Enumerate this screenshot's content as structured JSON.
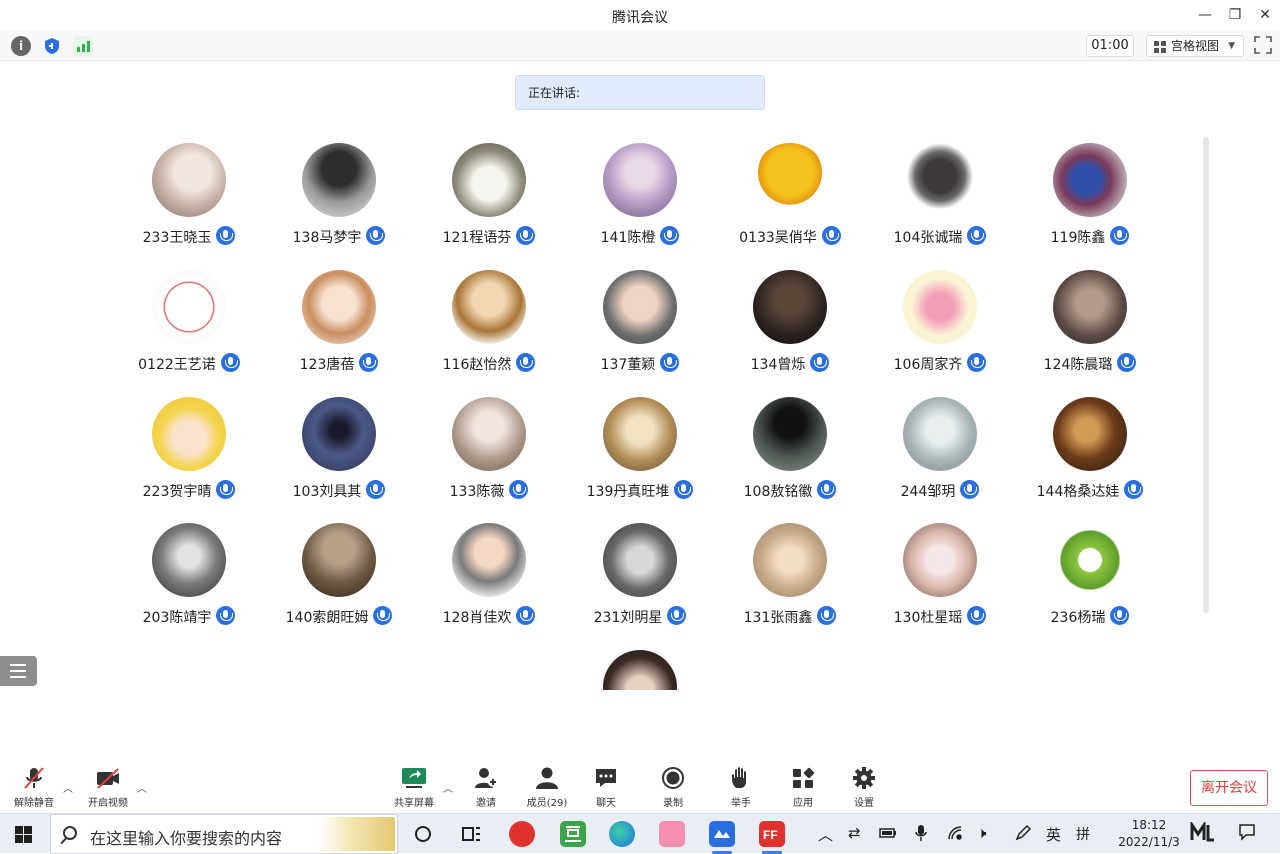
{
  "window": {
    "title": "腾讯会议",
    "controls": [
      "—",
      "❐",
      "✕"
    ]
  },
  "toolbar": {
    "timer": "01:00",
    "view_label": "宫格视图"
  },
  "speaking": {
    "label": "正在讲话:"
  },
  "participants": [
    {
      "name": "233王晓玉",
      "avatar_bg": "radial-gradient(circle at 55% 40%, #f1e6df 0 30%, #c7b3a6 55%, #7b6a60 100%)"
    },
    {
      "name": "138马梦宇",
      "avatar_bg": "radial-gradient(circle at 50% 35%, #2d2d2d 0 28%, #9a9a9a 55%, #e5e5e5 100%)"
    },
    {
      "name": "121程语芬",
      "avatar_bg": "radial-gradient(circle at 50% 55%, #f5f5f0 0 30%, #8e8a78 60%, #4b4538 100%)"
    },
    {
      "name": "141陈橙",
      "avatar_bg": "radial-gradient(circle at 50% 40%, #e9d9e6 0 25%, #b39bc4 55%, #6a5a7d 100%)"
    },
    {
      "name": "0133吴俏华",
      "avatar_bg": "radial-gradient(circle at 50% 40%, #f4c21a 0 40%, #e79a12 55%, #ffffff 56%, #ffffff 100%)"
    },
    {
      "name": "104张诚瑞",
      "avatar_bg": "radial-gradient(circle at 50% 45%, #3e3a3a 0 30%, #6b6b6b 45%, #ffffff 60%, #ffffff 100%)"
    },
    {
      "name": "119陈鑫",
      "avatar_bg": "radial-gradient(circle at 45% 50%, #2d4ea8 0 25%, #7b3a5a 45%, #c9c2c8 80%)"
    },
    {
      "name": "0122王艺诺",
      "avatar_bg": "radial-gradient(circle at 50% 50%, #ffffff 0 45%, #d05a5a 47%, #ffffff 50%, #f7f0f0 100%)"
    },
    {
      "name": "123唐蓓",
      "avatar_bg": "radial-gradient(circle at 50% 45%, #f8e3d2 0 30%, #c98e5f 55%, #fdf4ec 100%)"
    },
    {
      "name": "116赵怡然",
      "avatar_bg": "radial-gradient(circle at 50% 40%, #f3d7b2 0 28%, #a77537 55%, #ffffff 80%)"
    },
    {
      "name": "137董颖",
      "avatar_bg": "radial-gradient(circle at 50% 45%, #f1d5c4 0 30%, #6e6e6e 60%, #3a4a3e 100%)"
    },
    {
      "name": "134曾烁",
      "avatar_bg": "radial-gradient(circle at 50% 40%, #5a4638 0 25%, #2a2220 60%, #0f0c0a 100%)"
    },
    {
      "name": "106周家齐",
      "avatar_bg": "radial-gradient(circle at 50% 50%, #f29cb6 0 25%, #fbf5d7 55%, #f6efc6 100%)"
    },
    {
      "name": "124陈晨璐",
      "avatar_bg": "radial-gradient(circle at 50% 45%, #b59a8a 0 25%, #5a4a44 60%, #2a2422 100%)"
    },
    {
      "name": "223贺宇晴",
      "avatar_bg": "radial-gradient(circle at 50% 55%, #fbe2cc 0 30%, #f3d44a 55%, #eac33a 100%)"
    },
    {
      "name": "103刘具其",
      "avatar_bg": "radial-gradient(circle at 50% 45%, #1a1a2a 0 15%, #4d5a88 45%, #283254 100%)"
    },
    {
      "name": "133陈薇",
      "avatar_bg": "radial-gradient(circle at 50% 40%, #f0e6df 0 25%, #a89384 60%, #6e5f55 100%)"
    },
    {
      "name": "139丹真旺堆",
      "avatar_bg": "radial-gradient(circle at 50% 45%, #f1e2c2 0 25%, #b58f5a 55%, #5a4632 100%)"
    },
    {
      "name": "108敖铭徽",
      "avatar_bg": "radial-gradient(circle at 50% 35%, #111 0 25%, #4f5752 55%, #8c948e 100%)"
    },
    {
      "name": "244邹玥",
      "avatar_bg": "radial-gradient(circle at 50% 45%, #e9eeee 0 25%, #a8b6b8 55%, #78868a 100%)"
    },
    {
      "name": "144格桑达娃",
      "avatar_bg": "radial-gradient(circle at 45% 45%, #d29a55 0 20%, #6b3c1a 50%, #2a180c 100%)"
    },
    {
      "name": "203陈靖宇",
      "avatar_bg": "radial-gradient(circle at 50% 45%, #e2e2e2 0 20%, #7c7c7c 50%, #2a2a2a 100%)"
    },
    {
      "name": "140索朗旺姆",
      "avatar_bg": "radial-gradient(circle at 50% 35%, #b8a088 0 25%, #6e5a44 55%, #2e2418 100%)"
    },
    {
      "name": "128肖佳欢",
      "avatar_bg": "radial-gradient(circle at 50% 40%, #f4d8c4 0 25%, #7a7a7a 50%, #f2f2f2 80%)"
    },
    {
      "name": "231刘明星",
      "avatar_bg": "radial-gradient(circle at 50% 50%, #d7d7d7 0 25%, #6a6a6a 55%, #2e2e2e 100%)"
    },
    {
      "name": "131张雨鑫",
      "avatar_bg": "radial-gradient(circle at 50% 50%, #f2dcc2 0 25%, #c7a988 55%, #8e7a66 100%)"
    },
    {
      "name": "130杜星瑶",
      "avatar_bg": "radial-gradient(circle at 50% 50%, #f6e7e7 0 25%, #d7b3a8 55%, #5a4a44 100%)"
    },
    {
      "name": "236杨瑞",
      "avatar_bg": "radial-gradient(circle at 50% 50%, #ffffff 0 22%, #8cc63f 24%, #5e9d2a 55%, #ffffff 58%, #ffffff 100%)"
    },
    {
      "name": "",
      "avatar_bg": "radial-gradient(circle at 50% 55%, #e8d0c2 0 25%, #3a2a24 60%, #1a1412 100%)"
    }
  ],
  "controls": {
    "mute_label": "解除静音",
    "video_label": "开启视频",
    "share_label": "共享屏幕",
    "invite_label": "邀请",
    "members_label": "成员(29)",
    "chat_label": "聊天",
    "record_label": "录制",
    "raise_hand_label": "举手",
    "apps_label": "应用",
    "settings_label": "设置",
    "leave_label": "离开会议"
  },
  "taskbar": {
    "search_placeholder": "在这里输入你要搜索的内容",
    "ime_lang": "英",
    "ime_mode": "拼",
    "time": "18:12",
    "date": "2022/11/3"
  },
  "colors": {
    "accent_blue": "#2a6fe0",
    "leave_red": "#e0403c",
    "speaking_bg": "#dfeafb"
  }
}
